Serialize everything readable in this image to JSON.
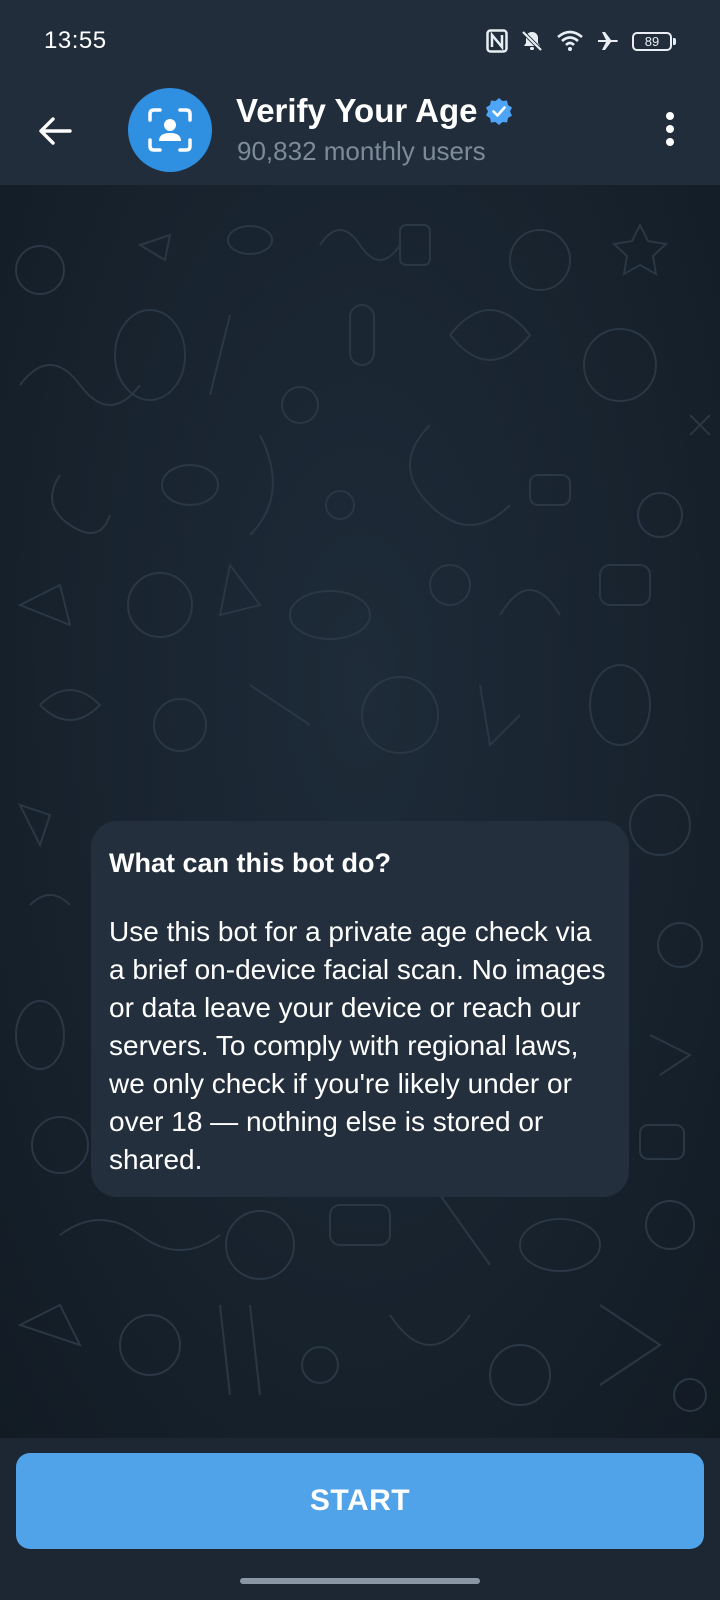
{
  "status_bar": {
    "time": "13:55",
    "battery_level": "89",
    "icons": [
      "nfc-icon",
      "bell-off-icon",
      "wifi-icon",
      "airplane-icon",
      "battery-icon"
    ]
  },
  "header": {
    "title": "Verify Your Age",
    "verified": true,
    "subtitle": "90,832 monthly users",
    "avatar_icon": "face-scan-icon",
    "back_icon": "arrow-left-icon",
    "menu_icon": "more-vertical-icon"
  },
  "bot_intro": {
    "title": "What can this bot do?",
    "body": "Use this bot for a private age check via a brief on-device facial scan. No images or data leave your device or reach our servers. To comply with regional laws, we only check if you're likely under or over 18 — nothing else is stored or shared."
  },
  "footer": {
    "start_label": "START"
  },
  "colors": {
    "header_bg": "#212d3b",
    "chat_bg": "#17222d",
    "bubble_bg": "#232f3c",
    "accent": "#50a2e9",
    "avatar_bg": "#2f8fe0",
    "verified_badge": "#4ea4f6",
    "subtitle": "#7d8b99"
  }
}
